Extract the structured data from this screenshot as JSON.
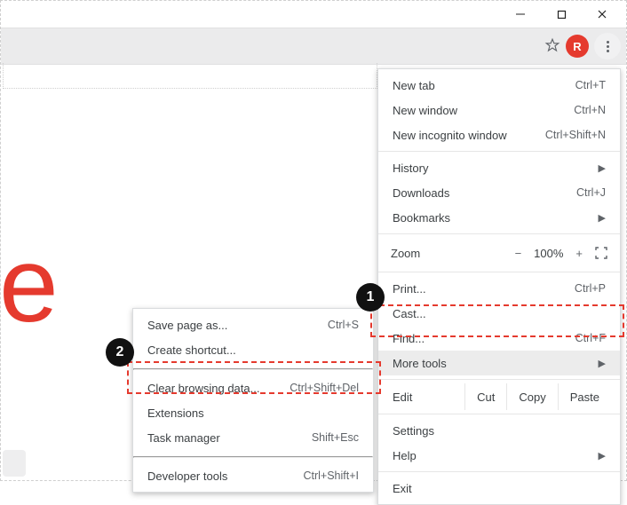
{
  "window_controls": {
    "minimize": "−",
    "maximize": "□",
    "close": "×"
  },
  "toolbar": {
    "avatar_letter": "R"
  },
  "logo_fragment": "e",
  "menu": {
    "new_tab": {
      "label": "New tab",
      "shortcut": "Ctrl+T"
    },
    "new_window": {
      "label": "New window",
      "shortcut": "Ctrl+N"
    },
    "new_incognito": {
      "label": "New incognito window",
      "shortcut": "Ctrl+Shift+N"
    },
    "history": {
      "label": "History"
    },
    "downloads": {
      "label": "Downloads",
      "shortcut": "Ctrl+J"
    },
    "bookmarks": {
      "label": "Bookmarks"
    },
    "zoom": {
      "label": "Zoom",
      "minus": "−",
      "pct": "100%",
      "plus": "+"
    },
    "print": {
      "label": "Print...",
      "shortcut": "Ctrl+P"
    },
    "cast": {
      "label": "Cast..."
    },
    "find": {
      "label": "Find...",
      "shortcut": "Ctrl+F"
    },
    "more_tools": {
      "label": "More tools"
    },
    "edit": {
      "label": "Edit",
      "cut": "Cut",
      "copy": "Copy",
      "paste": "Paste"
    },
    "settings": {
      "label": "Settings"
    },
    "help": {
      "label": "Help"
    },
    "exit": {
      "label": "Exit"
    }
  },
  "submenu": {
    "save_page": {
      "label": "Save page as...",
      "shortcut": "Ctrl+S"
    },
    "create_shortcut": {
      "label": "Create shortcut..."
    },
    "clear_data": {
      "label": "Clear browsing data...",
      "shortcut": "Ctrl+Shift+Del"
    },
    "extensions": {
      "label": "Extensions"
    },
    "task_manager": {
      "label": "Task manager",
      "shortcut": "Shift+Esc"
    },
    "dev_tools": {
      "label": "Developer tools",
      "shortcut": "Ctrl+Shift+I"
    }
  },
  "badges": {
    "one": "1",
    "two": "2"
  }
}
